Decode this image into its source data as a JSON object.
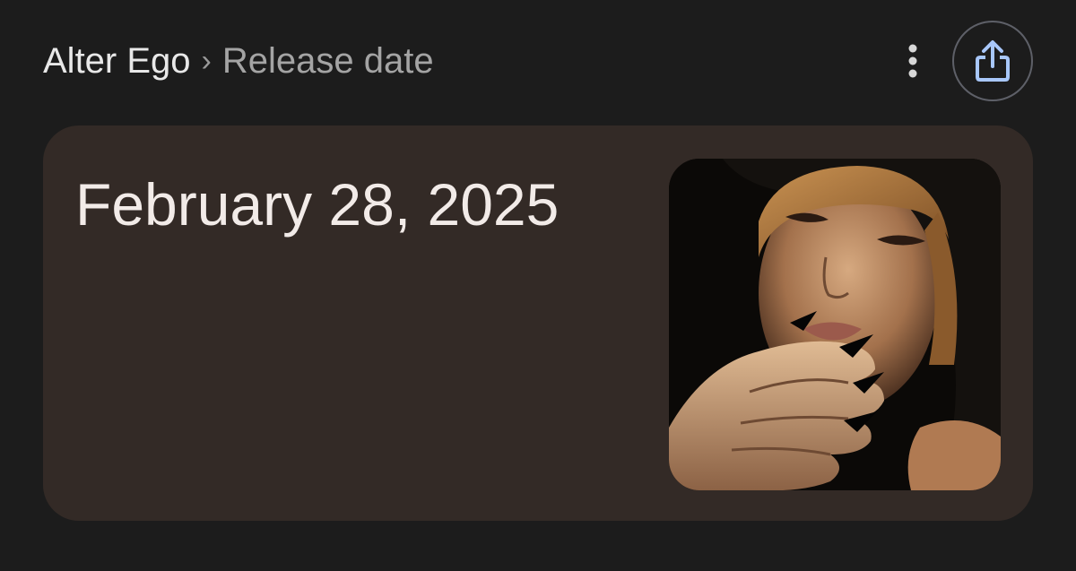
{
  "breadcrumb": {
    "topic": "Alter Ego",
    "separator": "›",
    "current": "Release date"
  },
  "actions": {
    "menu_icon": "more-vert-icon",
    "share_icon": "share-icon"
  },
  "answer": {
    "date": "February 28, 2025"
  },
  "colors": {
    "background": "#1c1c1c",
    "card": "#332a26",
    "share_icon": "#a8c7fa",
    "date_text": "#f2ebe8"
  }
}
